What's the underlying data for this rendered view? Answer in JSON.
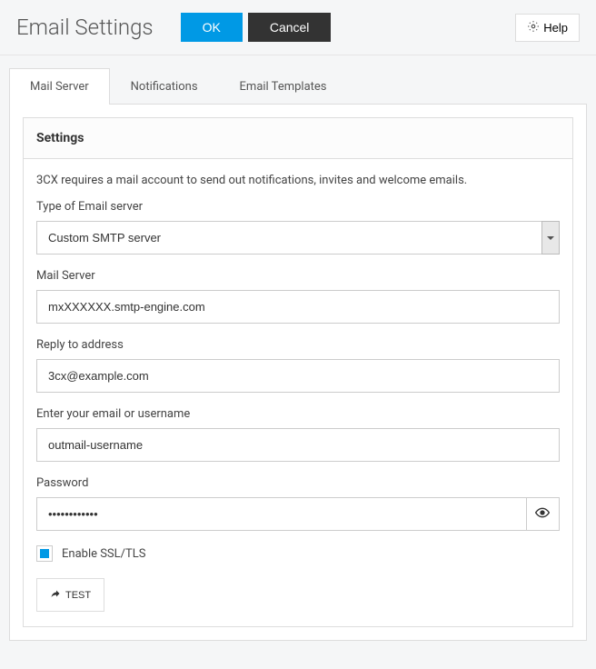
{
  "header": {
    "title": "Email Settings",
    "ok_label": "OK",
    "cancel_label": "Cancel",
    "help_label": "Help"
  },
  "tabs": [
    {
      "label": "Mail Server",
      "active": true
    },
    {
      "label": "Notifications",
      "active": false
    },
    {
      "label": "Email Templates",
      "active": false
    }
  ],
  "settings": {
    "card_title": "Settings",
    "intro": "3CX requires a mail account to send out notifications, invites and welcome emails.",
    "type_label": "Type of Email server",
    "type_value": "Custom SMTP server",
    "mail_server_label": "Mail Server",
    "mail_server_value": "mxXXXXXX.smtp-engine.com",
    "reply_to_label": "Reply to address",
    "reply_to_value": "3cx@example.com",
    "username_label": "Enter your email or username",
    "username_value": "outmail-username",
    "password_label": "Password",
    "password_value": "••••••••••••",
    "ssl_label": "Enable SSL/TLS",
    "ssl_checked": true,
    "test_label": "TEST"
  }
}
